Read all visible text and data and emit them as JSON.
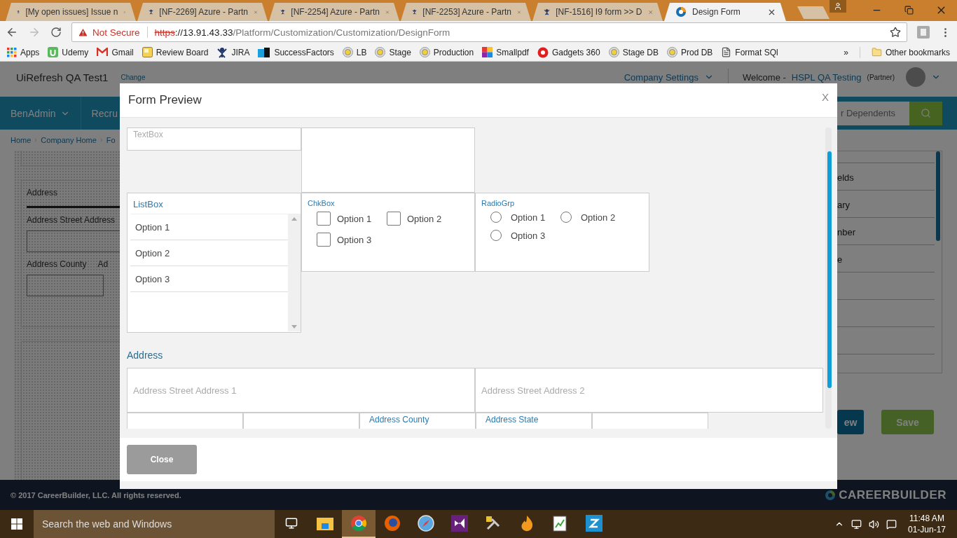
{
  "browser": {
    "tabs": [
      {
        "title": "[My open issues] Issue n",
        "kind": "jira",
        "selected": false
      },
      {
        "title": "[NF-2269] Azure - Partn",
        "kind": "jira",
        "selected": false
      },
      {
        "title": "[NF-2254] Azure - Partn",
        "kind": "jira",
        "selected": false
      },
      {
        "title": "[NF-2253] Azure - Partn",
        "kind": "jira",
        "selected": false
      },
      {
        "title": "[NF-1516] I9 form >> D",
        "kind": "jira",
        "selected": false
      },
      {
        "title": "Design Form",
        "kind": "site",
        "selected": true
      }
    ],
    "security": "Not Secure",
    "url_scheme": "https",
    "url_host": "://13.91.43.33",
    "url_path": "/Platform/Customization/Customization/DesignForm",
    "bookmarks": [
      {
        "label": "Apps",
        "kind": "apps"
      },
      {
        "label": "Udemy",
        "kind": "udemy"
      },
      {
        "label": "Gmail",
        "kind": "gmail"
      },
      {
        "label": "Review Board",
        "kind": "board"
      },
      {
        "label": "JIRA",
        "kind": "jira"
      },
      {
        "label": "SuccessFactors",
        "kind": "sf"
      },
      {
        "label": "LB",
        "kind": "target"
      },
      {
        "label": "Stage",
        "kind": "target"
      },
      {
        "label": "Production",
        "kind": "target"
      },
      {
        "label": "Smallpdf",
        "kind": "smallpdf"
      },
      {
        "label": "Gadgets 360",
        "kind": "gadgets"
      },
      {
        "label": "Stage DB",
        "kind": "target"
      },
      {
        "label": "Prod DB",
        "kind": "target"
      },
      {
        "label": "Format SQl",
        "kind": "file"
      }
    ],
    "overflow": "»",
    "other_bookmarks": "Other bookmarks"
  },
  "app": {
    "company": "UiRefresh QA Test1",
    "change": "Change",
    "company_settings": "Company Settings",
    "welcome": "Welcome -",
    "user": "HSPL QA Testing",
    "role": "(Partner)",
    "nav": [
      "BenAdmin",
      "Recru"
    ],
    "search_placeholder": "r Dependents",
    "breadcrumb": [
      "Home",
      "Company Home",
      "Fo"
    ],
    "designer": {
      "section": "Address",
      "street_label": "Address Street Address",
      "county_label": "Address County",
      "next_label": "Ad"
    },
    "fields_list": [
      "elds",
      "ary",
      "nber",
      "e"
    ],
    "buttons": [
      "ew",
      "Save"
    ],
    "footer": "© 2017 CareerBuilder, LLC. All rights reserved.",
    "logo": "CAREERBUILDER"
  },
  "modal": {
    "title": "Form Preview",
    "close_x": "X",
    "textbox_label": "TextBox",
    "listbox": {
      "label": "ListBox",
      "options": [
        {
          "label": "Option 1",
          "selected": false
        },
        {
          "label": "Option 2",
          "selected": false
        },
        {
          "label": "Option 3",
          "selected": false
        }
      ]
    },
    "checkbox_group": {
      "label": "ChkBox",
      "options": [
        {
          "label": "Option 1",
          "checked": false
        },
        {
          "label": "Option 2",
          "checked": false
        },
        {
          "label": "Option 3",
          "checked": false
        }
      ]
    },
    "radio_group": {
      "label": "RadioGrp",
      "options": [
        {
          "label": "Option 1",
          "selected": false
        },
        {
          "label": "Option 2",
          "selected": false
        },
        {
          "label": "Option 3",
          "selected": false
        }
      ]
    },
    "address": {
      "title": "Address",
      "street1_placeholder": "Address Street Address 1",
      "street2_placeholder": "Address Street Address 2",
      "county_label": "Address County",
      "state_label": "Address State"
    },
    "close_button": "Close"
  },
  "taskbar": {
    "search_placeholder": "Search the web and Windows",
    "apps": [
      {
        "kind": "taskview",
        "selected": false
      },
      {
        "kind": "explorer",
        "selected": false
      },
      {
        "kind": "chrome",
        "selected": true
      },
      {
        "kind": "firefox",
        "selected": false
      },
      {
        "kind": "compass",
        "selected": false
      },
      {
        "kind": "studio",
        "selected": false
      },
      {
        "kind": "tools",
        "selected": false
      },
      {
        "kind": "flame",
        "selected": false
      },
      {
        "kind": "notepad",
        "selected": false
      },
      {
        "kind": "zapp",
        "selected": false
      }
    ],
    "time": "11:48 AM",
    "date": "01-Jun-17"
  }
}
